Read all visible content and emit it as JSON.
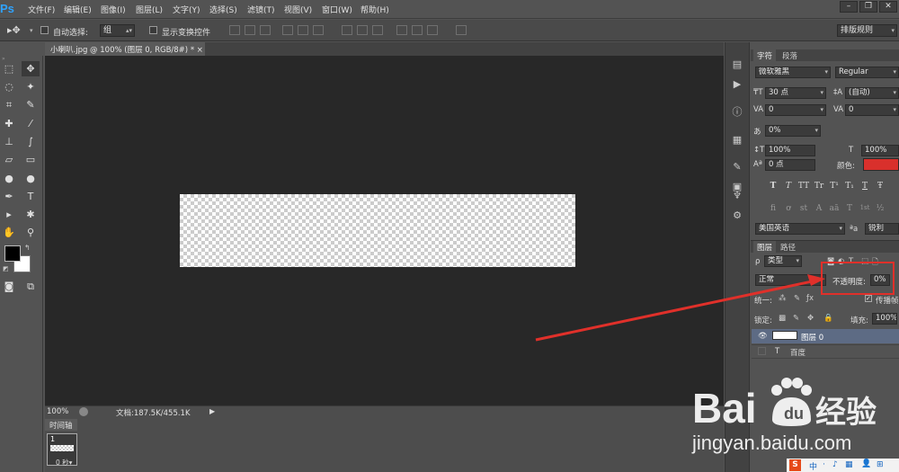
{
  "app": {
    "logo": "Ps"
  },
  "menubar": {
    "items": [
      "文件(F)",
      "编辑(E)",
      "图像(I)",
      "图层(L)",
      "文字(Y)",
      "选择(S)",
      "滤镜(T)",
      "视图(V)",
      "窗口(W)",
      "帮助(H)"
    ],
    "window_buttons": [
      "–",
      "❐",
      "✕"
    ]
  },
  "options": {
    "auto_select_label": "自动选择:",
    "auto_select_value": "组",
    "show_transform_label": "显示变换控件",
    "workspace": "排版规则"
  },
  "document": {
    "tab_title": "小喇叭.jpg @ 100% (图层 0, RGB/8#) *",
    "close": "×"
  },
  "status": {
    "zoom": "100%",
    "doc_info": "文档:187.5K/455.1K"
  },
  "timeline": {
    "tab": "时间轴",
    "frame_number": "1",
    "frame_delay": "0 秒▾"
  },
  "character": {
    "tabs": [
      "字符",
      "段落"
    ],
    "font_family": "微软雅黑",
    "font_style": "Regular",
    "font_size": "30 点",
    "leading": "(自动)",
    "kerning": "0",
    "tracking": "0",
    "tsume": "0%",
    "vscale": "100%",
    "hscale": "100%",
    "baseline": "0 点",
    "color_label": "颜色:",
    "color": "#d9302c",
    "type_buttons": [
      "T",
      "T",
      "TT",
      "Tr",
      "T¹",
      "T₁",
      "T",
      "Ŧ"
    ],
    "opentype_buttons": [
      "fi",
      "ơ",
      "st",
      "A",
      "aā",
      "T",
      "1st",
      "½"
    ],
    "language": "美国英语",
    "aa_label": "ªa",
    "antialias": "锐利"
  },
  "layers": {
    "tabs": [
      "图层",
      "路径"
    ],
    "filter_kind": "类型",
    "blend_mode": "正常",
    "opacity_label": "不透明度:",
    "opacity_value": "0%",
    "unify_label": "统一:",
    "propagate_label": "传播帧",
    "lock_label": "锁定:",
    "fill_label": "填充:",
    "fill_value": "100%",
    "rows": [
      {
        "name": "图层 0",
        "selected": true
      },
      {
        "name": "百度",
        "type": "text"
      }
    ]
  },
  "watermark": {
    "brand": "Bai",
    "brand2": "经验",
    "url": "jingyan.baidu.com"
  },
  "tray": {
    "items": [
      "S",
      "中",
      "·",
      "♪",
      "▦",
      "👤",
      "⊞"
    ]
  }
}
